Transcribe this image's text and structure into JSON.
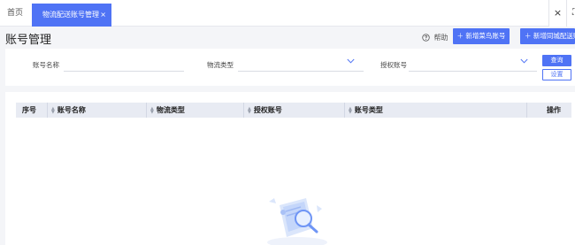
{
  "tabs": {
    "home": "首页",
    "active": "物流配送账号管理",
    "active_close": "×"
  },
  "toolbar": {
    "close_all": "×",
    "fullscreen": "⛶"
  },
  "header": {
    "title": "账号管理",
    "help": "帮助",
    "btn_new_cainiao": "＋ 新增菜鸟账号",
    "btn_new_tongcheng": "＋ 新增同城配送账号"
  },
  "filters": {
    "account_name": "账号名称",
    "logistics_type": "物流类型",
    "auth_account": "授权账号",
    "query": "查询",
    "settings": "设置"
  },
  "table": {
    "columns": [
      "序号",
      "账号名称",
      "物流类型",
      "授权账号",
      "账号类型",
      "操作"
    ]
  },
  "colors": {
    "accent": "#4f73f5"
  }
}
